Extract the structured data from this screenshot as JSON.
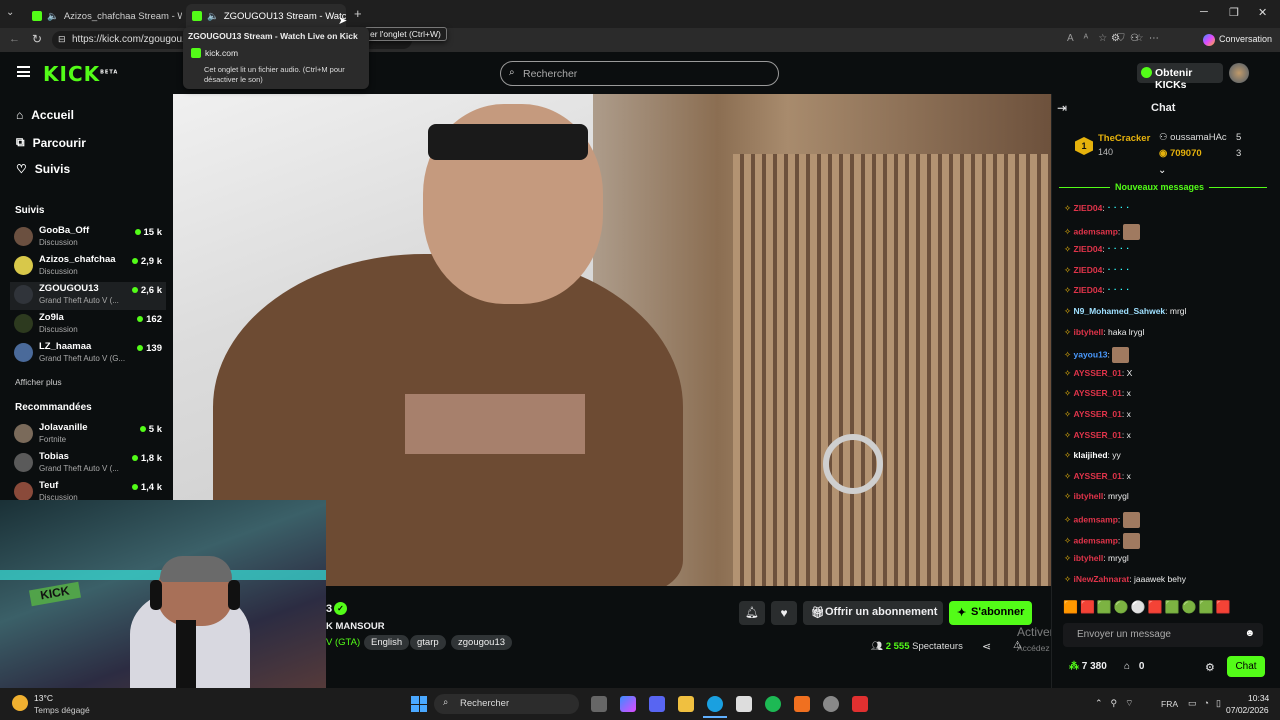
{
  "browser": {
    "tabs": [
      {
        "title": "Azizos_chafchaa Stream - Wat"
      },
      {
        "title": "ZGOUGOU13 Stream - Watch"
      }
    ],
    "url": "https://kick.com/zgougou1",
    "profile_button": "Conversation",
    "close_tooltip": "er l'onglet (Ctrl+W)",
    "hover_card": {
      "title": "ZGOUGOU13 Stream - Watch Live on Kick",
      "domain": "kick.com",
      "note": "Cet onglet lit un fichier audio. (Ctrl+M pour désactiver le son)"
    }
  },
  "header": {
    "logo": "KICK",
    "beta": "BETA",
    "search_placeholder": "Rechercher",
    "kicks_button": "Obtenir KICKs"
  },
  "sidebar": {
    "nav": [
      {
        "label": "Accueil",
        "icon": "home-icon"
      },
      {
        "label": "Parcourir",
        "icon": "browse-icon"
      },
      {
        "label": "Suivis",
        "icon": "heart-icon"
      }
    ],
    "followed_title": "Suivis",
    "followed": [
      {
        "name": "GooBa_Off",
        "category": "Discussion",
        "viewers": "15 k",
        "color": "#6b5040"
      },
      {
        "name": "Azizos_chafchaa",
        "category": "Discussion",
        "viewers": "2,9 k",
        "color": "#d8c84a"
      },
      {
        "name": "ZGOUGOU13",
        "category": "Grand Theft Auto V (...",
        "viewers": "2,6 k",
        "color": "#30343a"
      },
      {
        "name": "Zo9la",
        "category": "Discussion",
        "viewers": "162",
        "color": "#2d3a1f"
      },
      {
        "name": "LZ_haamaa",
        "category": "Grand Theft Auto V (G...",
        "viewers": "139",
        "color": "#4a6a9a"
      }
    ],
    "show_more": "Afficher plus",
    "recommended_title": "Recommandées",
    "recommended": [
      {
        "name": "Jolavanille",
        "category": "Fortnite",
        "viewers": "5 k",
        "color": "#7a6a5a"
      },
      {
        "name": "Tobias",
        "category": "Grand Theft Auto V (...",
        "viewers": "1,8 k",
        "color": "#5a5a5a"
      },
      {
        "name": "Teuf",
        "category": "Discussion",
        "viewers": "1,4 k",
        "color": "#8a4a3a"
      }
    ]
  },
  "stream": {
    "name_fragment": "3",
    "title_fragment": "K MANSOUR",
    "category_fragment": "V (GTA)",
    "tags": [
      "English",
      "gtarp",
      "zgougou13"
    ],
    "gift_button": "Offrir un abonnement",
    "subscribe_button": "S'abonner",
    "viewers": "2 555",
    "viewers_label": "Spectateurs",
    "windows_watermark_1": "Activer Windows",
    "windows_watermark_2": "Accédez aux paramètres pour activer Windows."
  },
  "chat": {
    "title": "Chat",
    "leaderboard": [
      {
        "rank": "1",
        "name": "TheCracker",
        "value": "140",
        "extra": "5"
      },
      {
        "name": "oussamaHAc",
        "value": "709070",
        "extra": "3"
      }
    ],
    "new_messages": "Nouveaux messages",
    "messages": [
      {
        "user": "ZIED04",
        "text": "",
        "color": "#e0344a",
        "emote": "....."
      },
      {
        "user": "ademsamp",
        "text": "",
        "color": "#e0344a",
        "emote": "cat"
      },
      {
        "user": "ZIED04",
        "text": "",
        "color": "#e0344a",
        "emote": "....."
      },
      {
        "user": "ZIED04",
        "text": "",
        "color": "#e0344a",
        "emote": "....."
      },
      {
        "user": "ZIED04",
        "text": "",
        "color": "#e0344a",
        "emote": "....."
      },
      {
        "user": "N9_Mohamed_Sahwek",
        "text": "mrgl",
        "color": "#9fe0ff",
        "emote": ""
      },
      {
        "user": "ibtyhell",
        "text": "haka lrygl",
        "color": "#e0344a",
        "emote": ""
      },
      {
        "user": "yayou13",
        "text": "",
        "color": "#4a9aff",
        "emote": "face"
      },
      {
        "user": "AYSSER_01",
        "text": "X",
        "color": "#e0344a",
        "emote": ""
      },
      {
        "user": "AYSSER_01",
        "text": "x",
        "color": "#e0344a",
        "emote": ""
      },
      {
        "user": "AYSSER_01",
        "text": "x",
        "color": "#e0344a",
        "emote": ""
      },
      {
        "user": "AYSSER_01",
        "text": "x",
        "color": "#e0344a",
        "emote": ""
      },
      {
        "user": "klaijihed",
        "text": "yy",
        "color": "#ffffff",
        "emote": ""
      },
      {
        "user": "AYSSER_01",
        "text": "x",
        "color": "#e0344a",
        "emote": ""
      },
      {
        "user": "ibtyhell",
        "text": "mrygl",
        "color": "#e0344a",
        "emote": ""
      },
      {
        "user": "ademsamp",
        "text": "",
        "color": "#e0344a",
        "emote": "cat"
      },
      {
        "user": "ademsamp",
        "text": "",
        "color": "#e0344a",
        "emote": "cat"
      },
      {
        "user": "ibtyhell",
        "text": "mrygl",
        "color": "#e0344a",
        "emote": ""
      },
      {
        "user": "iNewZahnarat",
        "text": "jaaawek behy",
        "color": "#e0344a",
        "emote": ""
      }
    ],
    "input_placeholder": "Envoyer un message",
    "points": "7 380",
    "gifts": "0",
    "send_button": "Chat"
  },
  "taskbar": {
    "weather_temp": "13°C",
    "weather_desc": "Temps dégagé",
    "search": "Rechercher",
    "lang": "FRA",
    "time": "10:34",
    "date": "07/02/2026"
  },
  "colors": {
    "accent": "#53fc18",
    "bg": "#0b0e0f"
  }
}
